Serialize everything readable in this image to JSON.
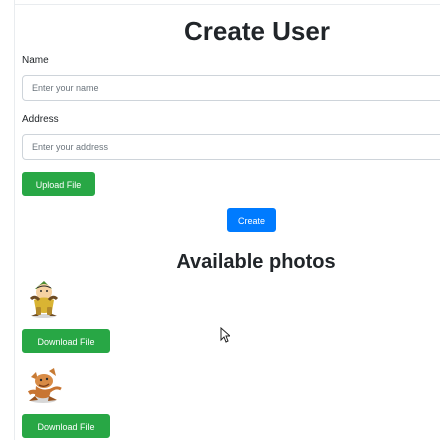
{
  "header": {
    "title": "Create User"
  },
  "form": {
    "name_label": "Name",
    "name_placeholder": "Enter your name",
    "address_label": "Address",
    "address_placeholder": "Enter your address",
    "upload_label": "Upload File",
    "create_label": "Create"
  },
  "photos": {
    "heading": "Available photos",
    "items": [
      {
        "image": "dwarf-cartoon",
        "download_label": "Download File"
      },
      {
        "image": "mouse-cartoon",
        "download_label": "Download File"
      }
    ]
  },
  "colors": {
    "primary": "#007bff",
    "success": "#28a745"
  }
}
